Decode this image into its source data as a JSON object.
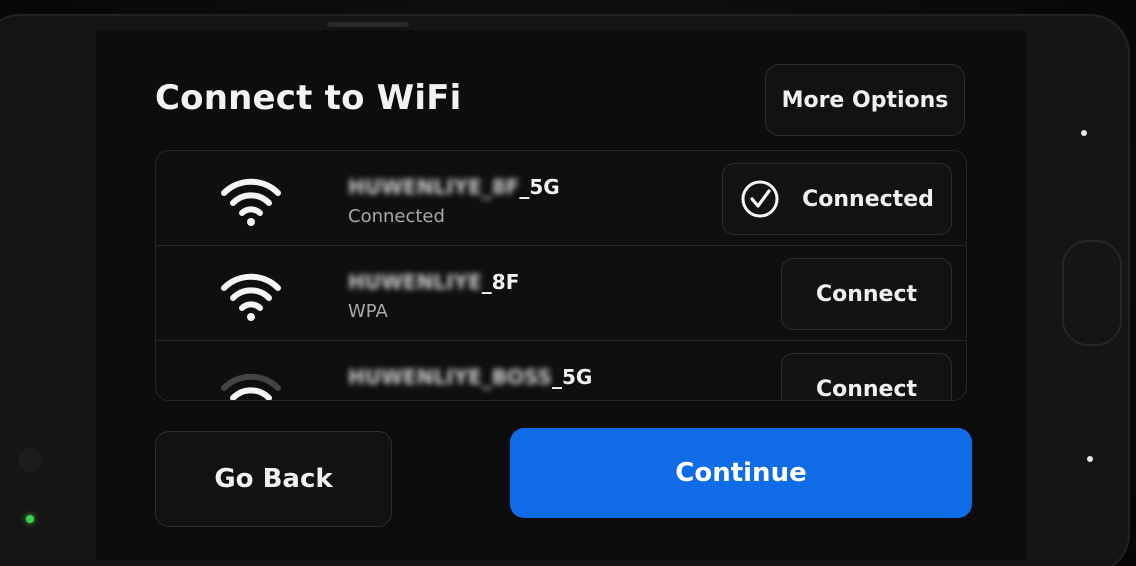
{
  "page": {
    "title": "Connect to WiFi",
    "more_options_label": "More Options"
  },
  "networks": [
    {
      "ssid_hidden": "HUWENLIYE_8F",
      "ssid_suffix": "_5G",
      "subtitle": "Connected",
      "action_label": "Connected",
      "action_icon": "check-circle-icon"
    },
    {
      "ssid_hidden": "HUWENLIYE",
      "ssid_suffix": "_8F",
      "subtitle": "WPA",
      "action_label": "Connect"
    },
    {
      "ssid_hidden": "HUWENLIYE_BOSS",
      "ssid_suffix": "_5G",
      "action_label": "Connect"
    }
  ],
  "footer": {
    "back_label": "Go Back",
    "continue_label": "Continue"
  },
  "colors": {
    "accent": "#0f6be6",
    "background": "#0d0d0d",
    "led": "#3bd14a"
  }
}
